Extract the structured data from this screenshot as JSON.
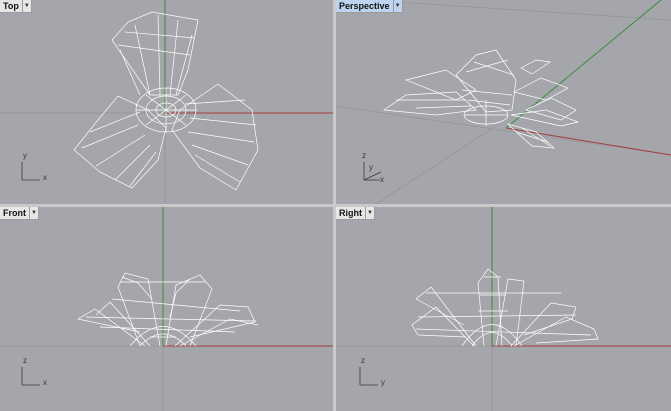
{
  "viewports": {
    "top": {
      "title": "Top",
      "axes": [
        "y",
        "x"
      ]
    },
    "perspective": {
      "title": "Perspective",
      "axes": [
        "z",
        "y",
        "x"
      ]
    },
    "front": {
      "title": "Front",
      "axes": [
        "z",
        "x"
      ]
    },
    "right": {
      "title": "Right",
      "axes": [
        "z",
        "y"
      ]
    }
  },
  "colors": {
    "viewport_bg": "#a4a6ab",
    "grid_line": "#8e9094",
    "x_axis": "#a23c3a",
    "y_axis": "#3c8a3f",
    "wire": "#ffffff",
    "active_tab": "#bcd4ef"
  },
  "icons": {
    "dropdown": "dropdown-arrow-icon",
    "model": "wireframe-plant-mesh"
  }
}
